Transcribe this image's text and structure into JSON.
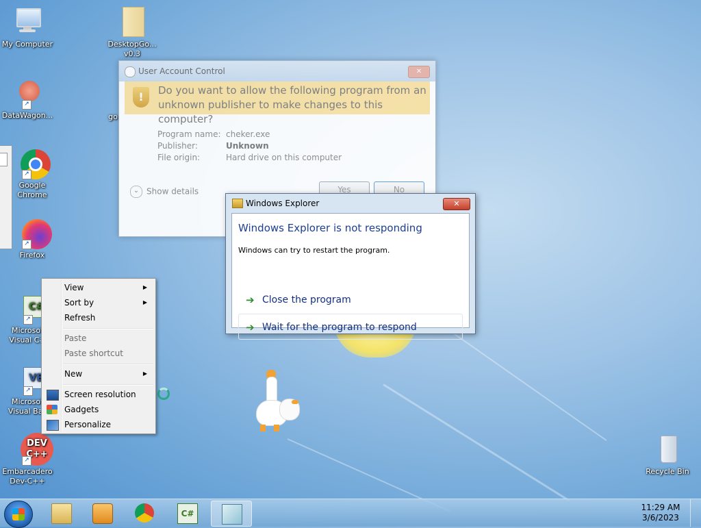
{
  "desktop": {
    "icons": [
      {
        "label": "My Computer",
        "icon": "computer-icon"
      },
      {
        "label": "DesktopGo...\nv0.3",
        "icon": "folder-icon"
      },
      {
        "label": "DataWagon...",
        "icon": "datawagon-icon"
      },
      {
        "label": "Google\nChrome",
        "icon": "chrome-icon"
      },
      {
        "label": "Firefox",
        "icon": "firefox-icon"
      },
      {
        "label": "Microsof\nVisual C#",
        "icon": "visual-csharp-icon"
      },
      {
        "label": "Microsof\nVisual Bas",
        "icon": "visual-basic-icon"
      },
      {
        "label": "Embarcadero\nDev-C++",
        "icon": "devcpp-icon"
      },
      {
        "label": "Recycle Bin",
        "icon": "recycle-bin-icon"
      }
    ],
    "partial_label": "go"
  },
  "uac": {
    "title": "User Account Control",
    "question": "Do you want to allow the following program from an unknown publisher to make changes to this computer?",
    "program_name_label": "Program name:",
    "program_name": "cheker.exe",
    "publisher_label": "Publisher:",
    "publisher": "Unknown",
    "file_origin_label": "File origin:",
    "file_origin": "Hard drive on this computer",
    "show_details": "Show details",
    "yes": "Yes",
    "no": "No"
  },
  "explorer_dialog": {
    "title": "Windows Explorer",
    "heading": "Windows Explorer is not responding",
    "message": "Windows can try to restart the program.",
    "option_close": "Close the program",
    "option_wait": "Wait for the program to respond"
  },
  "context_menu": {
    "view": "View",
    "sort_by": "Sort by",
    "refresh": "Refresh",
    "paste": "Paste",
    "paste_shortcut": "Paste shortcut",
    "new": "New",
    "screen_resolution": "Screen resolution",
    "gadgets": "Gadgets",
    "personalize": "Personalize"
  },
  "taskbar": {
    "time": "11:29 AM",
    "date": "3/6/2023",
    "buttons": [
      "file-explorer-icon",
      "media-player-icon",
      "chrome-icon",
      "visual-csharp-icon",
      "desktop-goose-icon"
    ]
  }
}
